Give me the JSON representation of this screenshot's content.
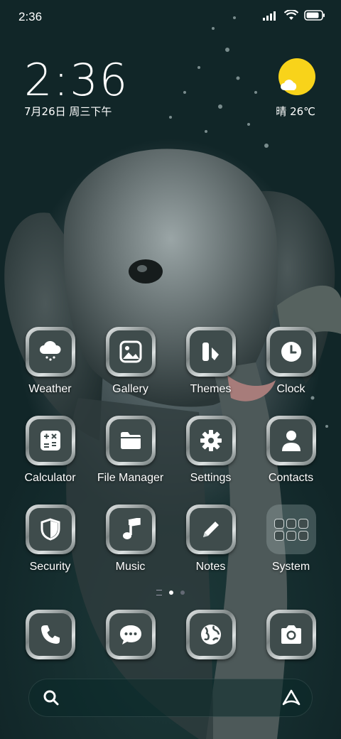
{
  "status_bar": {
    "time": "2:36",
    "battery_level": 0.85
  },
  "lockscreen": {
    "clock": "2:36",
    "date": "7月26日 周三下午"
  },
  "weather": {
    "condition": "晴",
    "temperature": "26℃",
    "sun_color": "#f8d31a"
  },
  "apps": [
    {
      "label": "Weather",
      "icon": "cloud-rain-icon"
    },
    {
      "label": "Gallery",
      "icon": "image-icon"
    },
    {
      "label": "Themes",
      "icon": "themes-icon"
    },
    {
      "label": "Clock",
      "icon": "clock-icon"
    },
    {
      "label": "Calculator",
      "icon": "calculator-icon"
    },
    {
      "label": "File Manager",
      "icon": "folder-icon"
    },
    {
      "label": "Settings",
      "icon": "gear-icon"
    },
    {
      "label": "Contacts",
      "icon": "person-icon"
    },
    {
      "label": "Security",
      "icon": "shield-icon"
    },
    {
      "label": "Music",
      "icon": "music-note-icon"
    },
    {
      "label": "Notes",
      "icon": "pencil-icon"
    },
    {
      "label": "System",
      "icon": "folder-grid-icon"
    }
  ],
  "dock": [
    {
      "icon": "phone-icon"
    },
    {
      "icon": "message-icon"
    },
    {
      "icon": "globe-icon"
    },
    {
      "icon": "camera-icon"
    }
  ],
  "search": {
    "icon": "search-icon",
    "assistant_icon": "assistant-icon"
  },
  "pages": {
    "count": 2,
    "current": 1
  }
}
